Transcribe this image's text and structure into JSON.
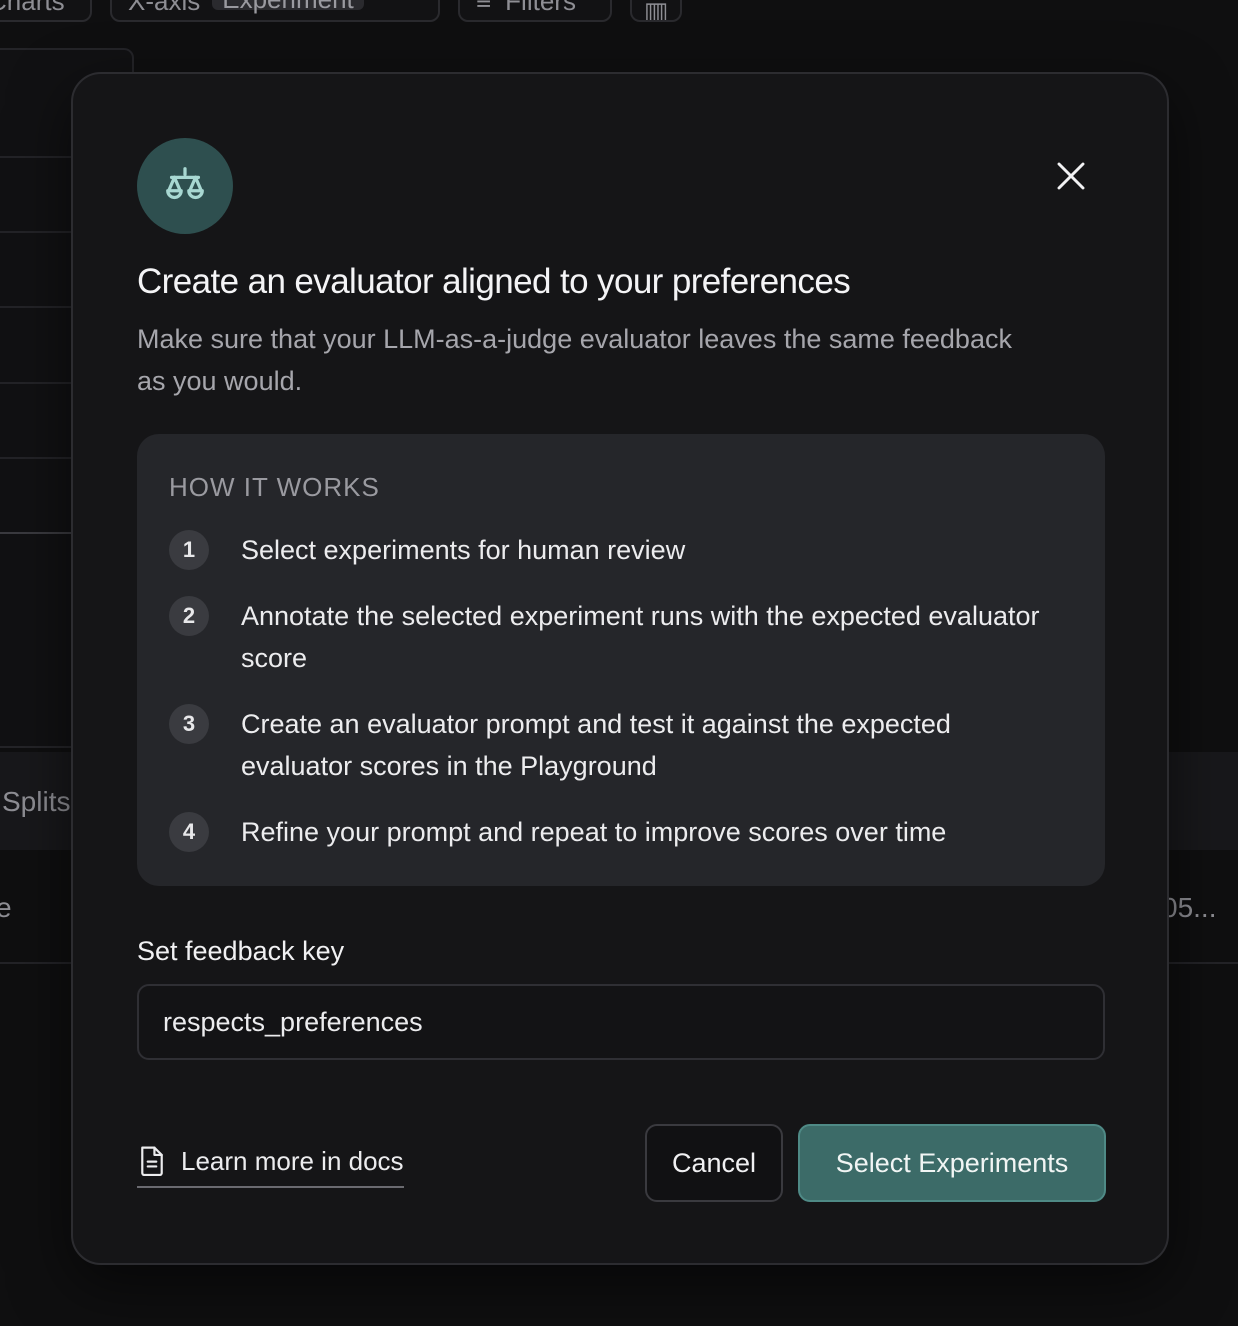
{
  "background": {
    "toolbar": {
      "charts_label": "Charts",
      "xaxis_label": "X-axis",
      "xaxis_value": "Experiment",
      "filters_label": "Filters"
    },
    "splits_label": "Splits",
    "row_tail_left": "e",
    "row_tail_right": "05..."
  },
  "modal": {
    "icon": "scale-icon",
    "title": "Create an evaluator aligned to your preferences",
    "subtitle": "Make sure that your LLM-as-a-judge evaluator leaves the same feedback as you would.",
    "how_it_works": {
      "heading": "HOW IT WORKS",
      "steps": [
        {
          "number": "1",
          "text": "Select experiments for human review"
        },
        {
          "number": "2",
          "text": "Annotate the selected experiment runs with the expected evaluator score"
        },
        {
          "number": "3",
          "text": "Create an evaluator prompt and test it against the expected evaluator scores in the Playground"
        },
        {
          "number": "4",
          "text": "Refine your prompt and repeat to improve scores over time"
        }
      ]
    },
    "feedback_key": {
      "label": "Set feedback key",
      "value": "respects_preferences"
    },
    "docs_link": {
      "label": "Learn more in docs",
      "icon": "document-icon"
    },
    "cancel_label": "Cancel",
    "primary_label": "Select Experiments"
  },
  "colors": {
    "accent": "#3c6b68",
    "accent_border": "#4f8a86",
    "badge_bg": "#2e4f4f",
    "icon_tint": "#a8d8d2",
    "modal_bg": "#151517",
    "panel_bg": "#25262a"
  }
}
